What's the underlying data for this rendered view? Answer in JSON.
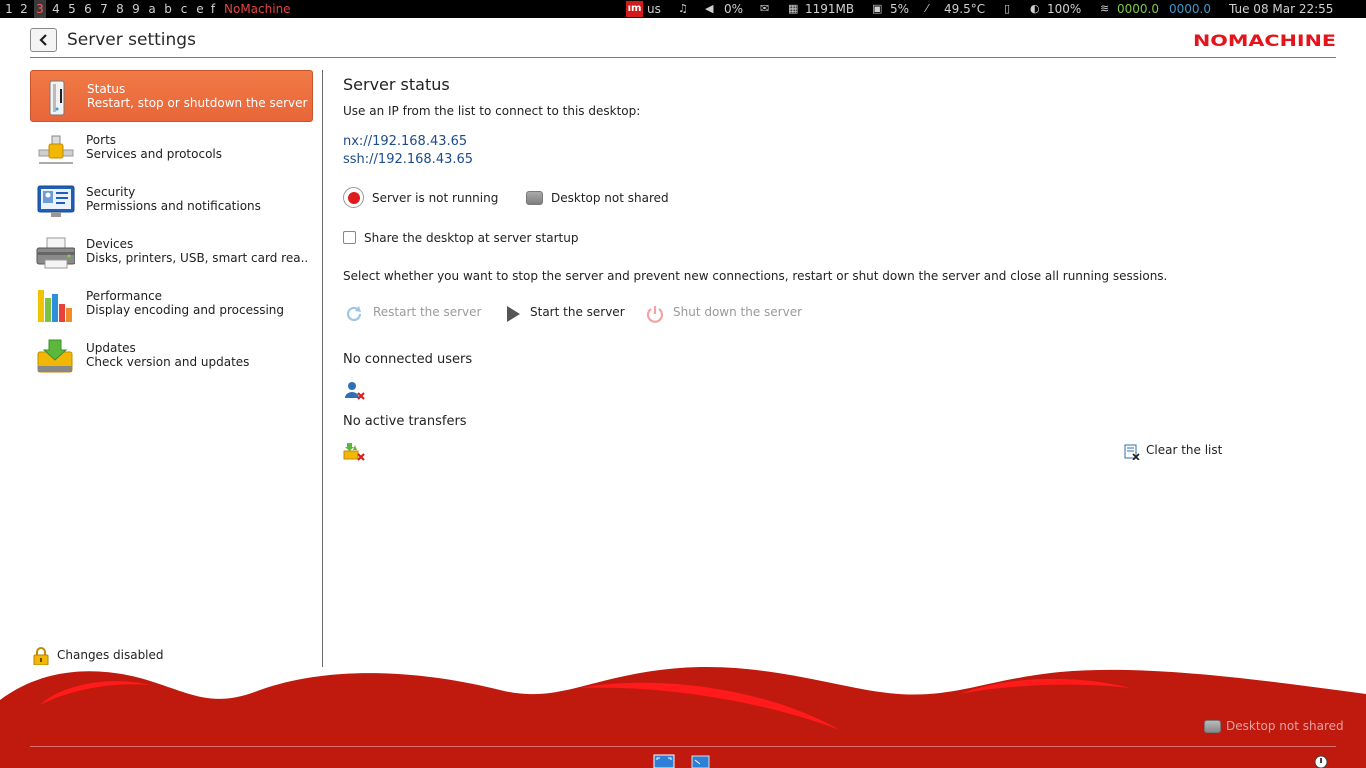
{
  "topbar": {
    "workspaces": [
      "1",
      "2",
      "3",
      "4",
      "5",
      "6",
      "7",
      "8",
      "9",
      "a",
      "b",
      "c",
      "e",
      "f"
    ],
    "active_workspace": "3",
    "window_title": "NoMachine",
    "ime_badge": "ım",
    "keyboard_layout": "us",
    "volume": "0%",
    "memory": "1191MB",
    "cpu": "5%",
    "temperature": "49.5°C",
    "battery": "100%",
    "net_down": "0000.0",
    "net_up": "0000.0",
    "datetime": "Tue 08 Mar 22:55",
    "icons": [
      "music-note-icon",
      "speaker-icon",
      "mail-icon",
      "memory-icon",
      "cpu-icon",
      "thermometer-icon",
      "battery-icon",
      "brightness-icon",
      "wifi-icon"
    ]
  },
  "header": {
    "title": "Server settings",
    "back_icon": "chevron-left-icon",
    "logo_text": "NOMACHINE",
    "brand_color": "#e5131b"
  },
  "sidebar": {
    "items": [
      {
        "title": "Status",
        "subtitle": "Restart, stop or shutdown the server",
        "icon": "server-icon",
        "selected": true
      },
      {
        "title": "Ports",
        "subtitle": "Services and protocols",
        "icon": "ports-icon",
        "selected": false
      },
      {
        "title": "Security",
        "subtitle": "Permissions and notifications",
        "icon": "security-icon",
        "selected": false
      },
      {
        "title": "Devices",
        "subtitle": "Disks, printers, USB, smart card rea...",
        "icon": "printer-icon",
        "selected": false
      },
      {
        "title": "Performance",
        "subtitle": "Display encoding and processing",
        "icon": "bar-chart-icon",
        "selected": false
      },
      {
        "title": "Updates",
        "subtitle": "Check version and updates",
        "icon": "download-icon",
        "selected": false
      }
    ],
    "changes_label": "Changes disabled",
    "selected_color": "#ee7240"
  },
  "main": {
    "title": "Server status",
    "intro": "Use an IP from the list to connect to this desktop:",
    "ips": [
      "nx://192.168.43.65",
      "ssh://192.168.43.65"
    ],
    "server_state": "Server is not running",
    "desktop_state": "Desktop not shared",
    "share_checkbox_label": "Share the desktop at server startup",
    "share_checked": false,
    "description": "Select whether you want to stop the server and prevent new connections, restart or shut down the server and close all running sessions.",
    "actions": {
      "restart": {
        "label": "Restart the server",
        "enabled": false
      },
      "start": {
        "label": "Start the server",
        "enabled": true
      },
      "shutdown": {
        "label": "Shut down the server",
        "enabled": false
      }
    },
    "users_heading": "No connected users",
    "transfers_heading": "No active transfers",
    "clear_label": "Clear the list"
  },
  "footer": {
    "desktop_state": "Desktop not shared",
    "wave_color": "#bf1a0d"
  }
}
